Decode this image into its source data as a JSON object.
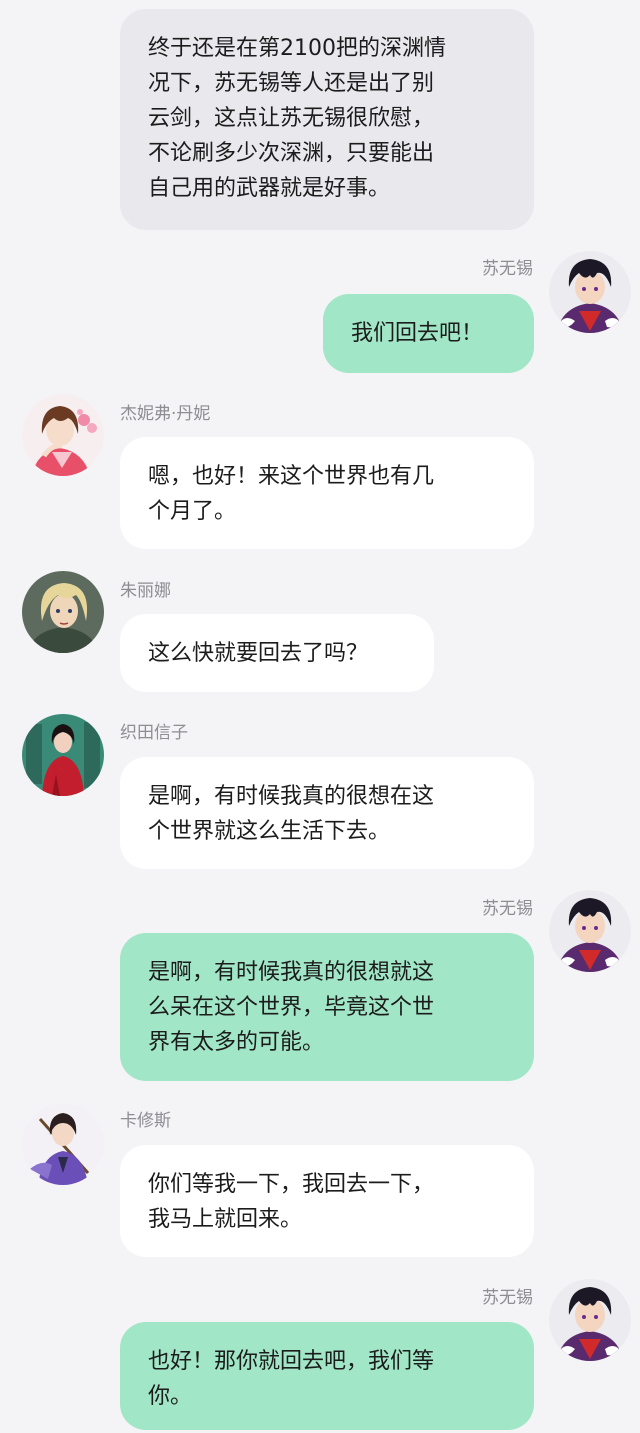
{
  "messages": [
    {
      "type": "narration",
      "text": "终于还是在第2100把的深渊情\n况下，苏无锡等人还是出了别\n云剑，这点让苏无锡很欣慰，\n不论刷多少次深渊，只要能出\n自己用的武器就是好事。"
    },
    {
      "type": "outgoing",
      "sender": "苏无锡",
      "avatar": "black-haired-prince-avatar",
      "text": "我们回去吧！"
    },
    {
      "type": "incoming",
      "sender": "杰妮弗·丹妮",
      "avatar": "girl-in-pink-kimono-avatar",
      "text": "嗯，也好！来这个世界也有几\n个月了。"
    },
    {
      "type": "incoming",
      "sender": "朱丽娜",
      "avatar": "blonde-woman-avatar",
      "text": "这么快就要回去了吗？"
    },
    {
      "type": "incoming",
      "sender": "织田信子",
      "avatar": "woman-in-red-avatar",
      "text": "是啊，有时候我真的很想在这\n个世界就这么生活下去。"
    },
    {
      "type": "outgoing",
      "sender": "苏无锡",
      "avatar": "black-haired-prince-avatar",
      "text": "是啊，有时候我真的很想就这\n么呆在这个世界，毕竟这个世\n界有太多的可能。"
    },
    {
      "type": "incoming",
      "sender": "卡修斯",
      "avatar": "swordsman-in-purple-avatar",
      "text": "你们等我一下，我回去一下，\n我马上就回来。"
    },
    {
      "type": "outgoing",
      "sender": "苏无锡",
      "avatar": "black-haired-prince-avatar",
      "text": "也好！那你就回去吧，我们等\n你。"
    }
  ],
  "colors": {
    "background": "#f4f4f7",
    "narration_bubble": "#e9e9ed",
    "incoming_bubble": "#ffffff",
    "outgoing_bubble": "#a1e6c6",
    "sender_name": "#8d8d92"
  }
}
